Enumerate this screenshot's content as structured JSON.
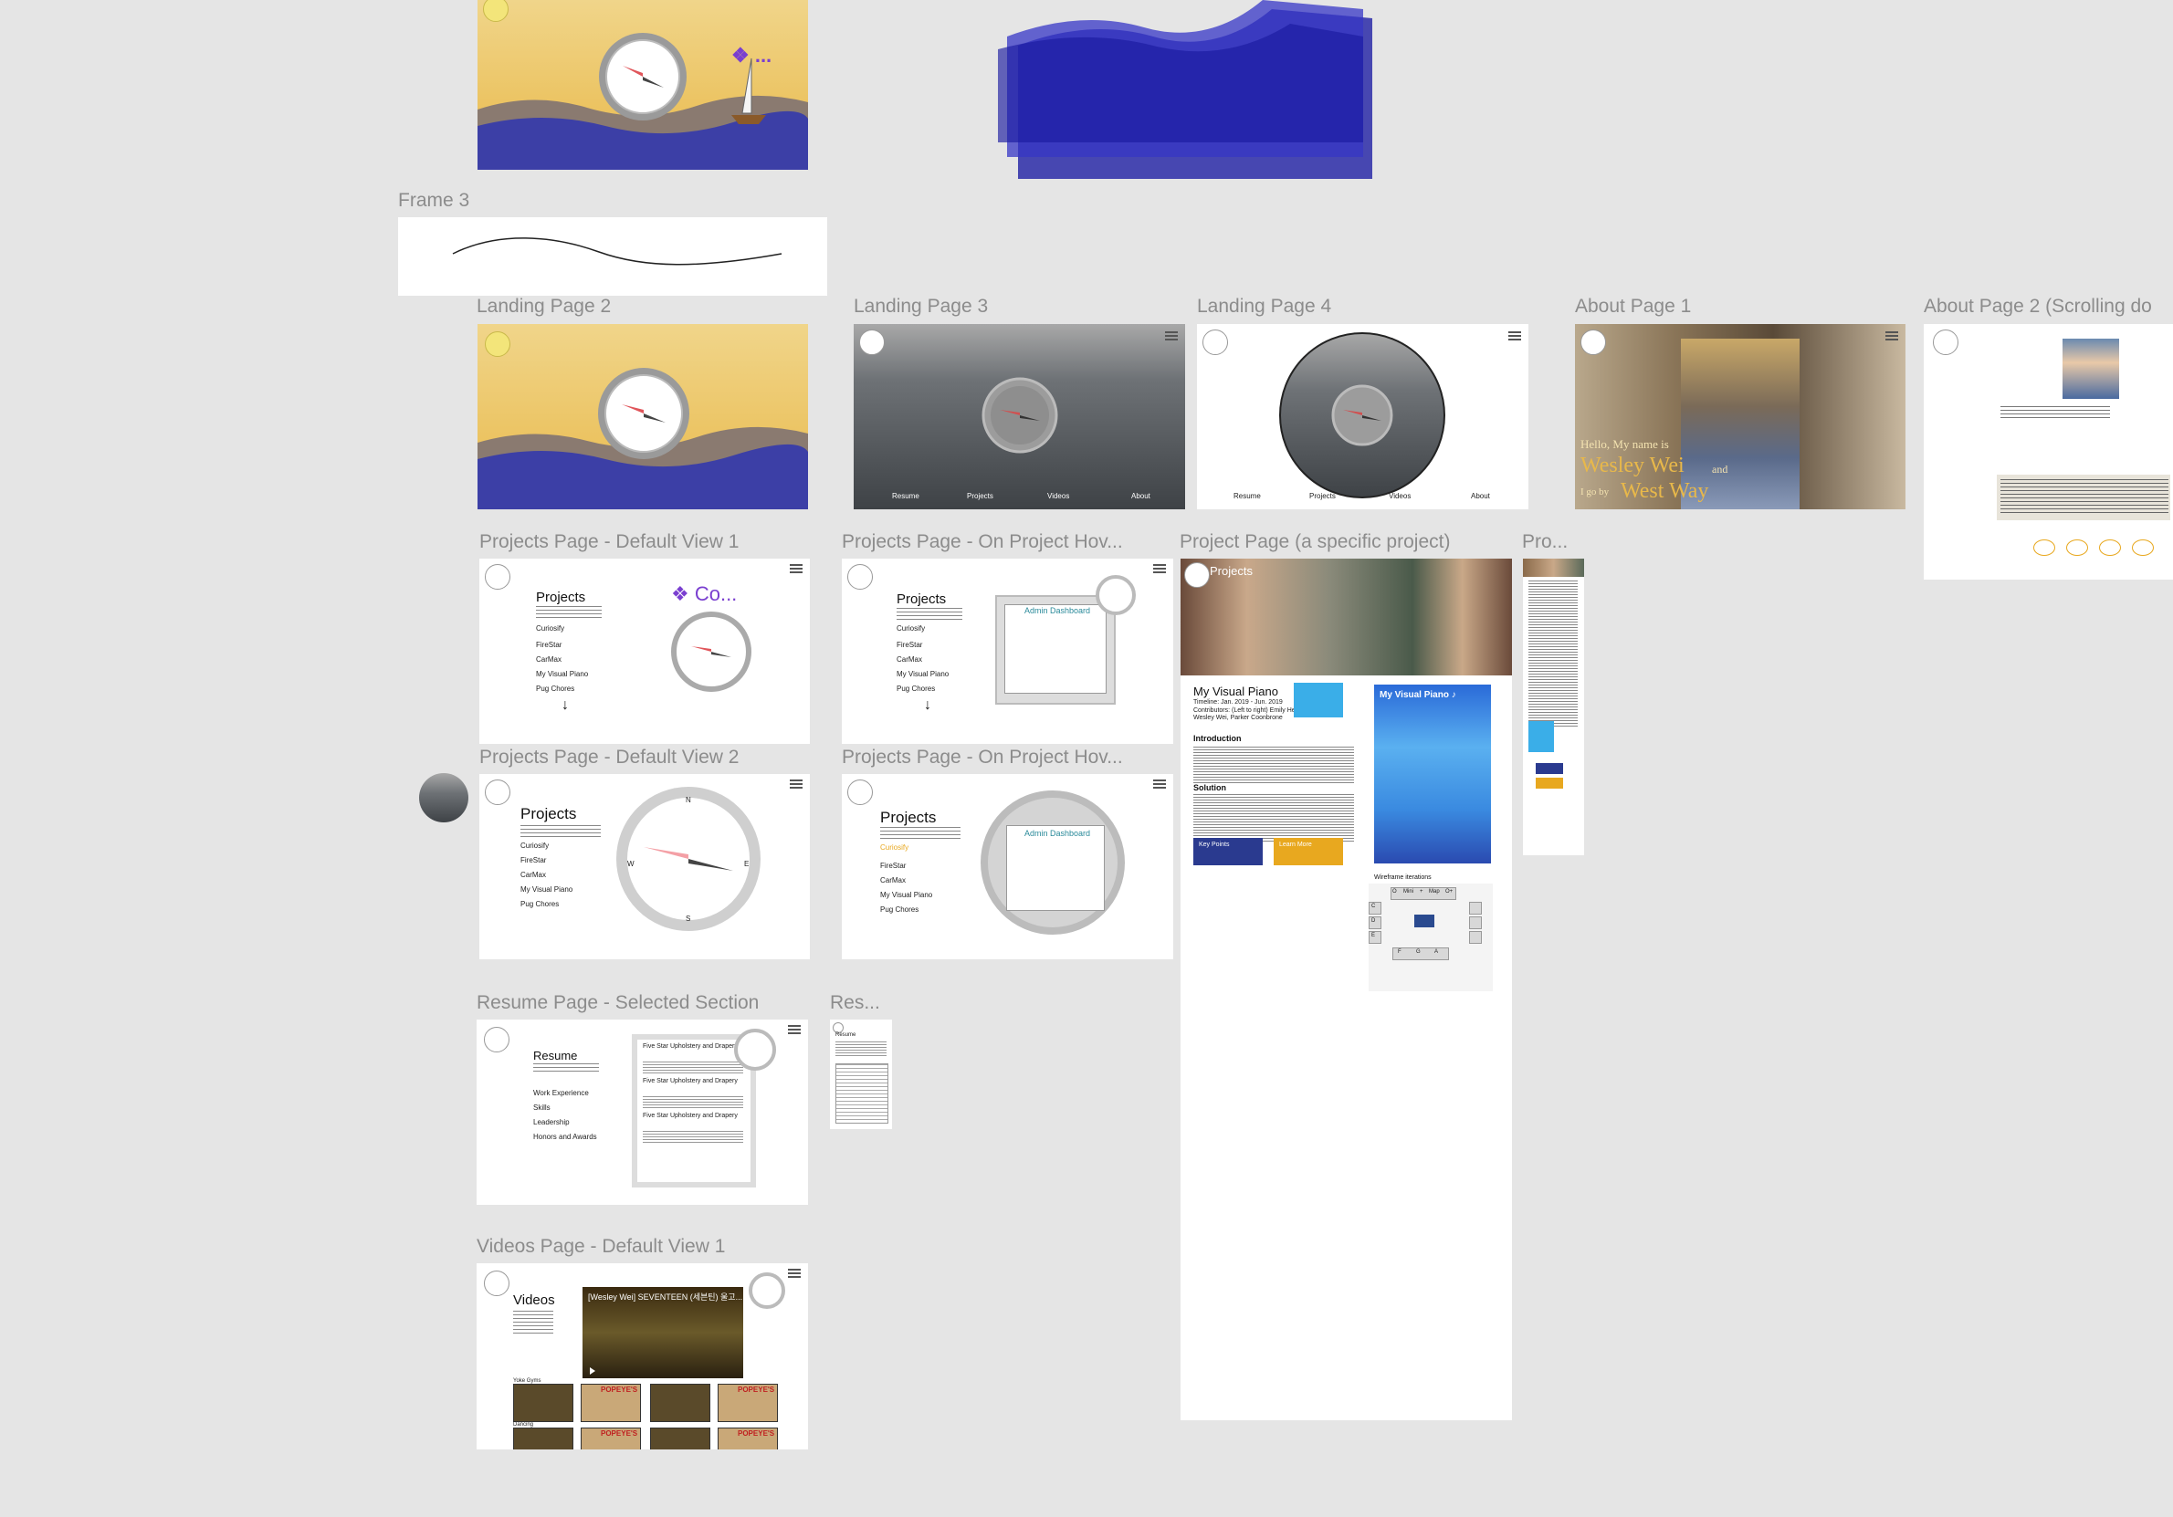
{
  "canvas": {
    "background": "#e5e5e5"
  },
  "frames": {
    "frame3": "Frame 3",
    "landing2": "Landing Page 2",
    "landing3": "Landing Page 3",
    "landing4": "Landing Page 4",
    "about1": "About Page 1",
    "about2": "About Page 2 (Scrolling do",
    "projects_default1": "Projects Page - Default View 1",
    "projects_hover1": "Projects Page - On Project Hov...",
    "project_specific": "Project Page (a specific project)",
    "pro_trunc": "Pro...",
    "projects_default2": "Projects Page - Default View 2",
    "projects_hover2": "Projects Page - On Project Hov...",
    "resume_selected": "Resume Page - Selected Section",
    "res_trunc": "Res...",
    "videos_default1": "Videos Page - Default View 1"
  },
  "landing_nav": [
    "Resume",
    "Projects",
    "Videos",
    "About"
  ],
  "landing1": {
    "badge": "❖ ..."
  },
  "projects_list": [
    "Curiosify",
    "FireStar",
    "CarMax",
    "My Visual Piano",
    "Pug Chores"
  ],
  "projects_page": {
    "heading": "Projects",
    "badge": "❖ Co...",
    "arrow": "↓",
    "admin": "Admin Dashboard",
    "compass": {
      "n": "N",
      "s": "S",
      "e": "E",
      "w": "W"
    }
  },
  "project_specific": {
    "header": "Projects",
    "title": "My Visual Piano",
    "timeline": "Timeline: Jan. 2019 - Jun. 2019",
    "contributors": "Contributors: (Left to right) Emily He, Cole Franck, Wesley Wei, Parker Coonbrone",
    "intro_heading": "Introduction",
    "solution_heading": "Solution",
    "key_points": "Key Points",
    "learn_more": "Learn More",
    "poster_title": "My Visual Piano ♪",
    "wireframe_heading": "Wireframe iterations",
    "wire_row": [
      "O",
      "Mini",
      "+",
      "Map",
      "O+"
    ],
    "wire_c": "C",
    "wire_d": "D",
    "wire_e": "E",
    "wire_bottom": [
      "F",
      "G",
      "A"
    ]
  },
  "about": {
    "name_line1": "Hello, My name is",
    "name": "Wesley Wei",
    "name_and": "and",
    "line2": "I go by",
    "nickname": "West Way"
  },
  "resume": {
    "heading": "Resume",
    "sections": [
      "Work Experience",
      "Skills",
      "Leadership",
      "Honors and Awards"
    ],
    "entries": [
      "Five Star Upholstery and Drapery",
      "Five Star Upholstery and Drapery",
      "Five Star Upholstery and Drapery"
    ],
    "mini_heading": "Resume"
  },
  "videos": {
    "heading": "Videos",
    "player_title": "[Wesley Wei] SEVENTEEN (세븐틴) 울고...",
    "row1_label": "Yoke Gyms",
    "row2_label": "Dancing",
    "thumb_label": "POPEYE'S"
  }
}
